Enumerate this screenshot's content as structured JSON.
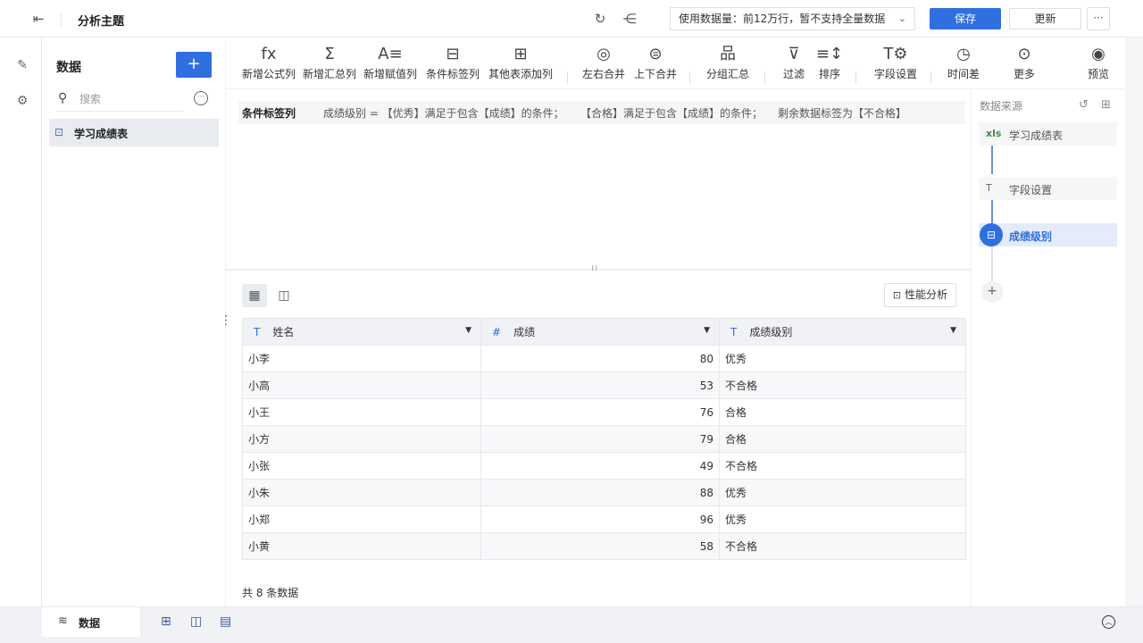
{
  "topbar": {
    "title": "分析主题",
    "data_select": "使用数据量：前12万行，暂不支持全量数据",
    "save_label": "保存",
    "update_label": "更新",
    "more_label": "···"
  },
  "rail": {
    "items": [
      "edit-icon",
      "settings-icon"
    ]
  },
  "data_panel": {
    "title": "数据",
    "add_label": "+",
    "search_placeholder": "搜索",
    "tables": [
      {
        "label": "学习成绩表"
      }
    ]
  },
  "toolbar": {
    "tools": [
      {
        "glyph": "fx",
        "label": "新增公式列"
      },
      {
        "glyph": "Σ",
        "label": "新增汇总列"
      },
      {
        "glyph": "A≡",
        "label": "新增赋值列"
      },
      {
        "glyph": "⊟",
        "label": "条件标签列"
      },
      {
        "glyph": "⊞",
        "label": "其他表添加列"
      },
      {
        "glyph": "◎",
        "label": "左右合并"
      },
      {
        "glyph": "⊜",
        "label": "上下合并"
      },
      {
        "glyph": "品",
        "label": "分组汇总"
      },
      {
        "glyph": "⊽",
        "label": "过滤"
      },
      {
        "glyph": "≡↕",
        "label": "排序"
      },
      {
        "glyph": "T⚙",
        "label": "字段设置"
      },
      {
        "glyph": "◷",
        "label": "时间差"
      },
      {
        "glyph": "⊙",
        "label": "更多"
      },
      {
        "glyph": "◉",
        "label": "预览"
      }
    ]
  },
  "condition": {
    "title": "条件标签列",
    "rule1": "成绩级别 = 【优秀】满足于包含【成绩】的条件；",
    "rule2": "【合格】满足于包含【成绩】的条件；",
    "rule3": "剩余数据标签为【不合格】"
  },
  "preview": {
    "perf_label": "性能分析",
    "columns": [
      {
        "type": "T",
        "name": "姓名"
      },
      {
        "type": "#",
        "name": "成绩"
      },
      {
        "type": "T",
        "name": "成绩级别"
      }
    ],
    "rows": [
      [
        "小李",
        "80",
        "优秀"
      ],
      [
        "小高",
        "53",
        "不合格"
      ],
      [
        "小王",
        "76",
        "合格"
      ],
      [
        "小方",
        "79",
        "合格"
      ],
      [
        "小张",
        "49",
        "不合格"
      ],
      [
        "小朱",
        "88",
        "优秀"
      ],
      [
        "小郑",
        "96",
        "优秀"
      ],
      [
        "小黄",
        "58",
        "不合格"
      ]
    ],
    "count_text": "共 8 条数据"
  },
  "right_panel": {
    "title": "数据来源",
    "steps": [
      {
        "icon": "xls",
        "label": "学习成绩表"
      },
      {
        "icon": "T",
        "label": "字段设置"
      },
      {
        "icon": "⊟",
        "label": "成绩级别"
      }
    ],
    "add_label": "+"
  },
  "bottom": {
    "tab_label": "数据"
  },
  "colors": {
    "accent": "#2f6fe0",
    "panel_bg": "#f0f2f5"
  }
}
